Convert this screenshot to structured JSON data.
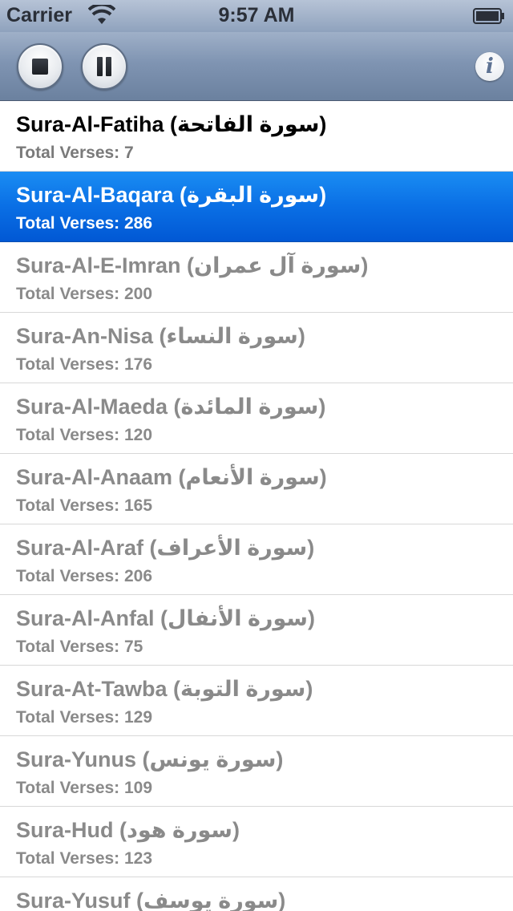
{
  "status_bar": {
    "carrier": "Carrier",
    "time": "9:57 AM"
  },
  "toolbar": {
    "stop_icon": "stop-icon",
    "pause_icon": "pause-icon",
    "info_label": "i"
  },
  "colors": {
    "selected_row": "#0a6fe5",
    "toolbar": "#7f94b2",
    "dim_text": "#8a8a8a"
  },
  "suras": [
    {
      "title": "Sura-Al-Fatiha (سورة الفاتحة)",
      "verses": "Total Verses: 7",
      "state": "active"
    },
    {
      "title": "Sura-Al-Baqara (سورة البقرة)",
      "verses": "Total Verses: 286",
      "state": "selected"
    },
    {
      "title": "Sura-Al-E-Imran (سورة آل عمران)",
      "verses": "Total Verses: 200",
      "state": "dim"
    },
    {
      "title": "Sura-An-Nisa (سورة النساء)",
      "verses": "Total Verses: 176",
      "state": "dim"
    },
    {
      "title": "Sura-Al-Maeda (سورة المائدة)",
      "verses": "Total Verses: 120",
      "state": "dim"
    },
    {
      "title": "Sura-Al-Anaam (سورة الأنعام)",
      "verses": "Total Verses: 165",
      "state": "dim"
    },
    {
      "title": "Sura-Al-Araf (سورة الأعراف)",
      "verses": "Total Verses: 206",
      "state": "dim"
    },
    {
      "title": "Sura-Al-Anfal (سورة الأنفال)",
      "verses": "Total Verses: 75",
      "state": "dim"
    },
    {
      "title": "Sura-At-Tawba (سورة التوبة)",
      "verses": "Total Verses: 129",
      "state": "dim"
    },
    {
      "title": "Sura-Yunus (سورة يونس)",
      "verses": "Total Verses: 109",
      "state": "dim"
    },
    {
      "title": "Sura-Hud (سورة هود)",
      "verses": "Total Verses: 123",
      "state": "dim"
    },
    {
      "title": "Sura-Yusuf (سورة يوسف)",
      "verses": "",
      "state": "dim"
    }
  ]
}
